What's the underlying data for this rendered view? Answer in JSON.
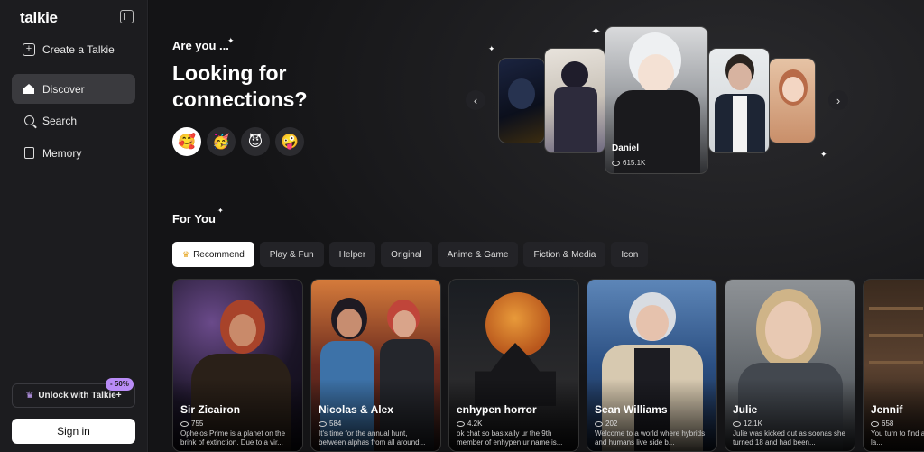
{
  "sidebar": {
    "logo": "talkie",
    "items": [
      {
        "label": "Create a Talkie",
        "icon": "plus-square-icon"
      },
      {
        "label": "Discover",
        "icon": "home-icon",
        "active": true
      },
      {
        "label": "Search",
        "icon": "search-icon"
      },
      {
        "label": "Memory",
        "icon": "memory-icon"
      }
    ],
    "unlock_label": "Unlock with Talkie+",
    "discount_badge": "- 50%",
    "signin_label": "Sign in"
  },
  "hero": {
    "small": "Are you ...",
    "title": "Looking for connections?",
    "emojis": [
      "🥰",
      "🥳",
      "😈",
      "🤪"
    ]
  },
  "carousel": {
    "featured_name": "Daniel",
    "featured_count": "615.1K"
  },
  "for_you": {
    "title": "For You",
    "tabs": [
      "Recommend",
      "Play & Fun",
      "Helper",
      "Original",
      "Anime & Game",
      "Fiction & Media",
      "Icon"
    ],
    "cards": [
      {
        "name": "Sir Zicairon",
        "count": "755",
        "desc": "Ophelos Prime is a planet on the brink of extinction. Due to a vir..."
      },
      {
        "name": "Nicolas & Alex",
        "count": "584",
        "desc": "It's time for the annual hunt, between alphas from all around..."
      },
      {
        "name": "enhypen horror",
        "count": "4.2K",
        "desc": "ok chat so basixally ur the 9th member of enhypen ur name is..."
      },
      {
        "name": "Sean Williams",
        "count": "202",
        "desc": "Welcome to a world where hybrids and humans live side b..."
      },
      {
        "name": "Julie",
        "count": "12.1K",
        "desc": "Julie was kicked out as soonas she turned 18 and had been..."
      },
      {
        "name": "Jennif",
        "count": "658",
        "desc": "You turn to find a la..."
      }
    ]
  },
  "colors": {
    "accent": "#b98cf6",
    "background": "#111113",
    "sidebar": "#1c1c1f"
  }
}
